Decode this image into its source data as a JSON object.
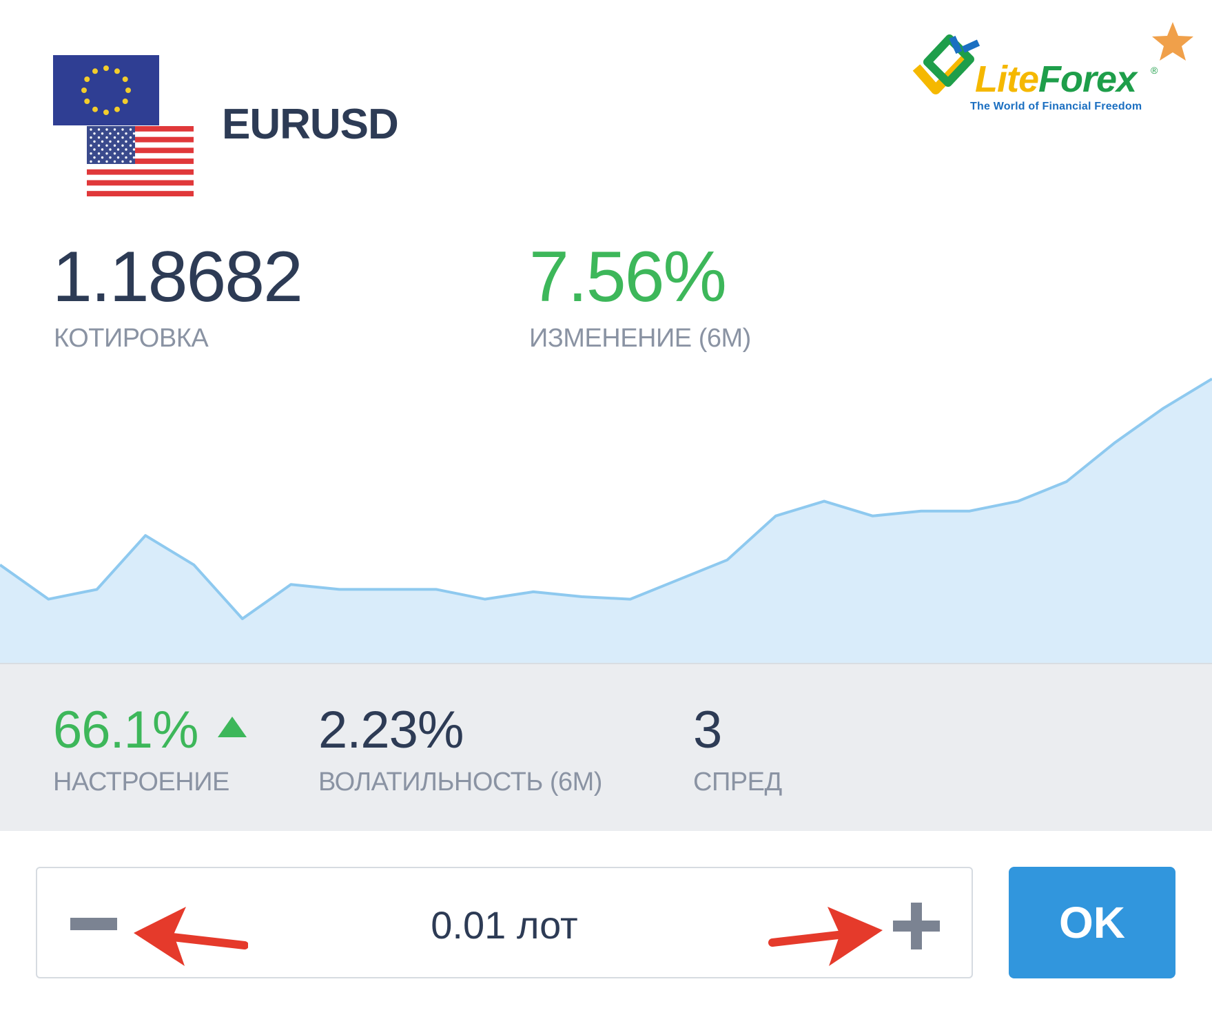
{
  "instrument": {
    "symbol": "EURUSD",
    "base_flag_icon": "eu-flag-icon",
    "quote_flag_icon": "us-flag-icon"
  },
  "brand": {
    "name_part1": "Lite",
    "name_part2": "Forex",
    "registered_mark": "®",
    "tagline": "The World of Financial Freedom",
    "favorite_icon": "star-icon",
    "colors": {
      "green": "#1e9e4a",
      "yellow": "#f5b800",
      "blue": "#1b6fc1",
      "star": "#f0a04a"
    }
  },
  "quote": {
    "value": "1.18682",
    "label": "КОТИРОВКА"
  },
  "change": {
    "value": "7.56%",
    "label": "ИЗМЕНЕНИЕ (6М)"
  },
  "chart_data": {
    "type": "area",
    "title": "",
    "xlabel": "",
    "ylabel": "",
    "grid": false,
    "legend": "none",
    "x": [
      0,
      1,
      2,
      3,
      4,
      5,
      6,
      7,
      8,
      9,
      10,
      11,
      12,
      13,
      14,
      15,
      16,
      17,
      18,
      19,
      20,
      21,
      22,
      23,
      24,
      25
    ],
    "values": [
      40,
      26,
      30,
      52,
      40,
      18,
      32,
      30,
      30,
      30,
      26,
      29,
      27,
      26,
      34,
      42,
      60,
      66,
      60,
      62,
      62,
      66,
      74,
      90,
      104,
      116
    ],
    "ylim": [
      0,
      130
    ],
    "line_color": "#8ec9ef",
    "fill_color": "#d9ecfa"
  },
  "stats": {
    "sentiment": {
      "value": "66.1%",
      "label": "НАСТРОЕНИЕ",
      "trend_icon": "triangle-up-icon",
      "color": "#3db75a"
    },
    "volatility": {
      "value": "2.23%",
      "label": "ВОЛАТИЛЬНОСТЬ (6М)"
    },
    "spread": {
      "value": "3",
      "label": "СПРЕД"
    }
  },
  "lot": {
    "value": "0.01 лот",
    "minus_icon": "minus-icon",
    "plus_icon": "plus-icon",
    "annotation_color": "#e53a2b"
  },
  "ok_button": {
    "label": "OK",
    "color": "#3196dd"
  }
}
